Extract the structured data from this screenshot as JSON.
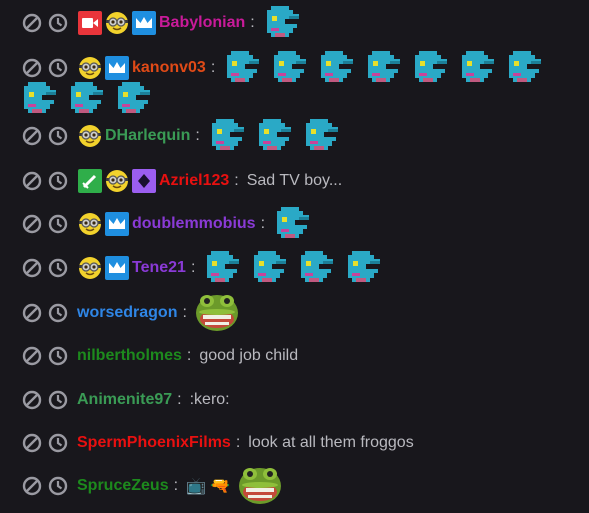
{
  "chat": {
    "messages": [
      {
        "username": "Babylonian",
        "name_color": "#c91a9a",
        "badges": [
          "video-badge",
          "minion-badge",
          "crown-badge"
        ],
        "text": "",
        "emotes": 1
      },
      {
        "username": "kanonv03",
        "name_color": "#e04a17",
        "badges": [
          "minion-badge",
          "crown-badge"
        ],
        "text": "",
        "emotes_line1": 7,
        "emotes_line2": 3
      },
      {
        "username": "DHarlequin",
        "name_color": "#3a9b55",
        "badges": [
          "minion-badge"
        ],
        "text": "",
        "emotes": 3
      },
      {
        "username": "Azriel123",
        "name_color": "#e81010",
        "badges": [
          "sword-badge",
          "minion-badge",
          "diamond-badge"
        ],
        "text": "Sad TV boy..."
      },
      {
        "username": "doublemmobius",
        "name_color": "#8a3ad6",
        "badges": [
          "minion-badge",
          "crown-badge"
        ],
        "text": "",
        "emotes": 1
      },
      {
        "username": "Tene21",
        "name_color": "#8a3ad6",
        "badges": [
          "minion-badge",
          "crown-badge"
        ],
        "text": "",
        "emotes": 4
      },
      {
        "username": "worsedragon",
        "name_color": "#2f86e6",
        "badges": [],
        "text": "",
        "frog": true
      },
      {
        "username": "nilbertholmes",
        "name_color": "#1d8a1d",
        "badges": [],
        "text": "good job child"
      },
      {
        "username": "Animenite97",
        "name_color": "#3a9b55",
        "badges": [],
        "text": ":kero:"
      },
      {
        "username": "SpermPhoenixFilms",
        "name_color": "#e81010",
        "badges": [],
        "text": "look at all them froggos"
      },
      {
        "username": "SpruceZeus",
        "name_color": "#1d8a1d",
        "badges": [],
        "text": "📺 🔫",
        "frog": true
      }
    ],
    "separator": ":"
  }
}
